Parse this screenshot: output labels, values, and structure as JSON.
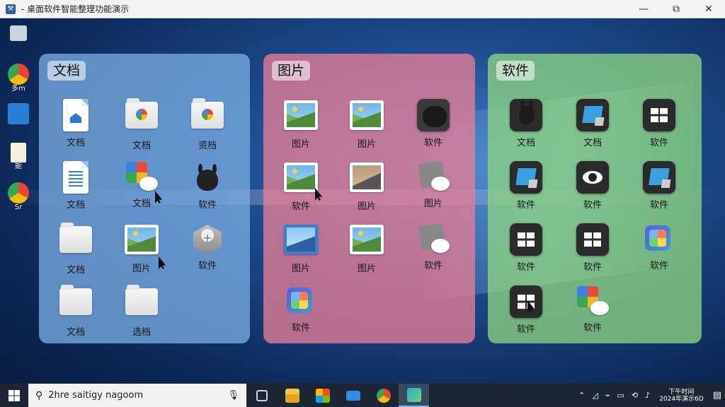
{
  "window": {
    "title": "- 桌面软件智能整理功能演示",
    "icon": "app-icon",
    "minimize": "—",
    "maximize": "⧉",
    "close": "✕"
  },
  "desktop_icons": [
    {
      "name": "recycle-bin-icon",
      "label": ""
    },
    {
      "name": "chrome-icon",
      "label": "多m"
    },
    {
      "name": "outlook-icon",
      "label": ""
    },
    {
      "name": "document-icon",
      "label": "能"
    },
    {
      "name": "chrome-icon",
      "label": "Sr"
    }
  ],
  "panels": {
    "docs": {
      "title": "文档",
      "items": [
        {
          "label": "文档",
          "icon": "document-home-icon"
        },
        {
          "label": "文档",
          "icon": "folder-photos-icon"
        },
        {
          "label": "资档",
          "icon": "folder-colorful-icon"
        },
        {
          "label": "文档",
          "icon": "text-document-icon"
        },
        {
          "label": "文档",
          "icon": "tiles-cloud-icon"
        },
        {
          "label": "软件",
          "icon": "rabbit-app-icon"
        },
        {
          "label": "文档",
          "icon": "folder-icon"
        },
        {
          "label": "图片",
          "icon": "image-icon"
        },
        {
          "label": "软件",
          "icon": "hexagon-app-icon"
        },
        {
          "label": "文档",
          "icon": "folder-icon"
        },
        {
          "label": "选档",
          "icon": "folder-icon"
        }
      ]
    },
    "pics": {
      "title": "图片",
      "items": [
        {
          "label": "图片",
          "icon": "image-icon"
        },
        {
          "label": "图片",
          "icon": "image-icon"
        },
        {
          "label": "软件",
          "icon": "black-blob-app-icon"
        },
        {
          "label": "软件",
          "icon": "image-icon"
        },
        {
          "label": "图片",
          "icon": "image-icon"
        },
        {
          "label": "图片",
          "icon": "photo-cloud-icon"
        },
        {
          "label": "图片",
          "icon": "blue-image-icon"
        },
        {
          "label": "图片",
          "icon": "image-icon"
        },
        {
          "label": "软件",
          "icon": "photo-cloud-icon"
        },
        {
          "label": "软件",
          "icon": "puzzle-app-icon"
        }
      ]
    },
    "soft": {
      "title": "软件",
      "items": [
        {
          "label": "文档",
          "icon": "rabbit-app-icon"
        },
        {
          "label": "文档",
          "icon": "slides-app-icon"
        },
        {
          "label": "软件",
          "icon": "grid-app-icon"
        },
        {
          "label": "软件",
          "icon": "slides-app-icon"
        },
        {
          "label": "软件",
          "icon": "eye-app-icon"
        },
        {
          "label": "软件",
          "icon": "slides-app-icon"
        },
        {
          "label": "软件",
          "icon": "grid-app-icon"
        },
        {
          "label": "软件",
          "icon": "grid-app-icon"
        },
        {
          "label": "软件",
          "icon": "puzzle-app-icon"
        },
        {
          "label": "软件",
          "icon": "grid-app-icon"
        },
        {
          "label": "软件",
          "icon": "tiles-cloud-icon"
        }
      ]
    }
  },
  "taskbar": {
    "search_text": "2hre saitigy nagoom",
    "apps": [
      "task-view-icon",
      "file-explorer-icon",
      "store-icon",
      "mail-icon",
      "chrome-icon",
      "photos-icon"
    ],
    "tray_clock_top": "下午时间",
    "tray_clock_bottom": "2024年演示6D"
  },
  "colors": {
    "docs_panel": "#78aae1",
    "pics_panel": "#e67d96",
    "soft_panel": "#8cd282",
    "taskbar": "#1b2533"
  }
}
